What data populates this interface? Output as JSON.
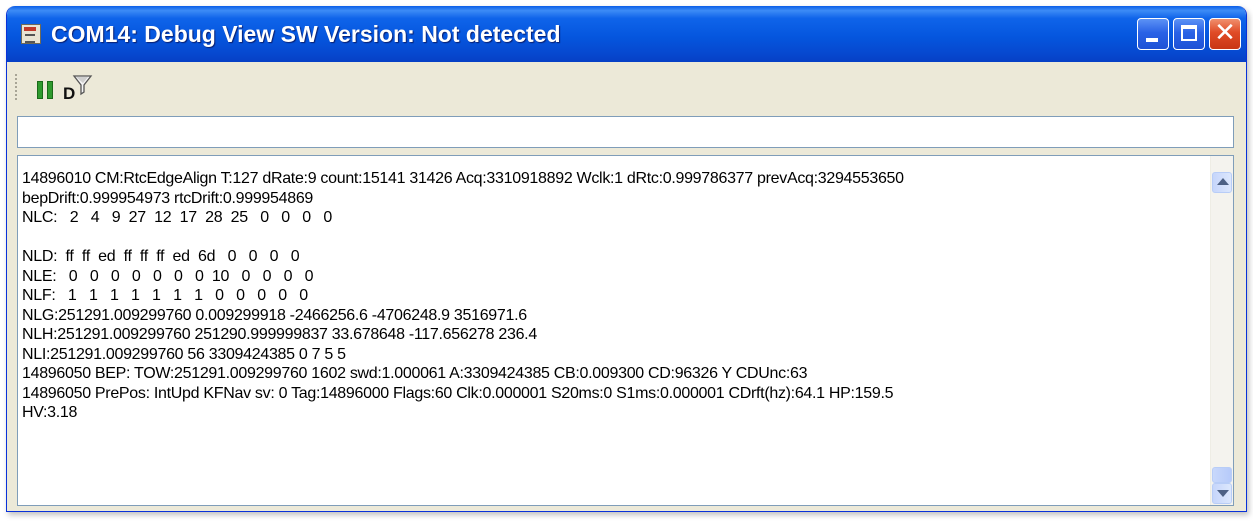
{
  "window": {
    "title": "COM14: Debug View SW Version: Not detected",
    "accent": "#0556de",
    "close_color": "#e04b26"
  },
  "titlebar_buttons": {
    "minimize_icon": "minimize-icon",
    "maximize_icon": "maximize-icon",
    "close_icon": "close-icon",
    "close_glyph": "✕"
  },
  "toolbar": {
    "pause_icon": "pause-icon",
    "filter_icon": "filter-icon",
    "filter_letter": "D"
  },
  "command_input": {
    "value": "",
    "placeholder": ""
  },
  "log": {
    "lines": [
      "14896010 CM:RtcEdgeAlign T:127 dRate:9 count:15141 31426 Acq:3310918892 Wclk:1 dRtc:0.999786377 prevAcq:3294553650",
      "bepDrift:0.999954973 rtcDrift:0.999954869",
      "NLC:   2   4   9  27  12  17  28  25   0   0   0   0",
      "",
      "NLD:  ff  ff  ed  ff  ff  ff  ed  6d   0   0   0   0",
      "NLE:   0   0   0   0   0   0   0  10   0   0   0   0",
      "NLF:   1   1   1   1   1   1   1   0   0   0   0   0",
      "NLG:251291.009299760 0.009299918 -2466256.6 -4706248.9 3516971.6",
      "NLH:251291.009299760 251290.999999837 33.678648 -117.656278 236.4",
      "NLI:251291.009299760 56 3309424385 0 7 5 5",
      "14896050 BEP: TOW:251291.009299760 1602 swd:1.000061 A:3309424385 CB:0.009300 CD:96326 Y CDUnc:63",
      "14896050 PrePos: IntUpd KFNav sv: 0 Tag:14896000 Flags:60 Clk:0.000001 S20ms:0 S1ms:0.000001 CDrft(hz):64.1 HP:159.5",
      "HV:3.18"
    ]
  },
  "scrollbar": {
    "up_icon": "scroll-up-arrow-icon",
    "down_icon": "scroll-down-arrow-icon",
    "position": 1.0
  }
}
